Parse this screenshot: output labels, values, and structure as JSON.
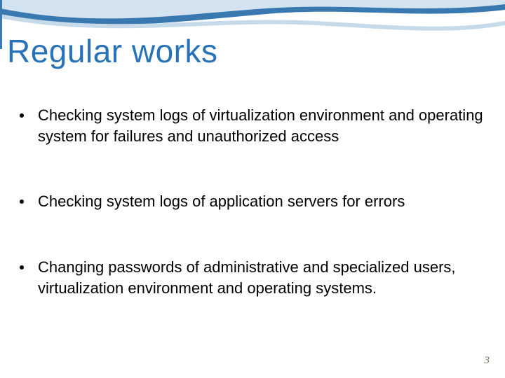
{
  "slide": {
    "title": "Regular works",
    "bullets": [
      "Checking system logs of virtualization environment and operating system for failures and unauthorized access",
      "Checking system logs of application servers for errors",
      "Changing passwords of administrative and specialized users, virtualization environment and operating systems."
    ],
    "page_number": "3"
  },
  "colors": {
    "title": "#2873b8",
    "wave_light": "#bdd6e8",
    "wave_dark": "#2f6fa8",
    "page_num": "#7a6a58"
  }
}
